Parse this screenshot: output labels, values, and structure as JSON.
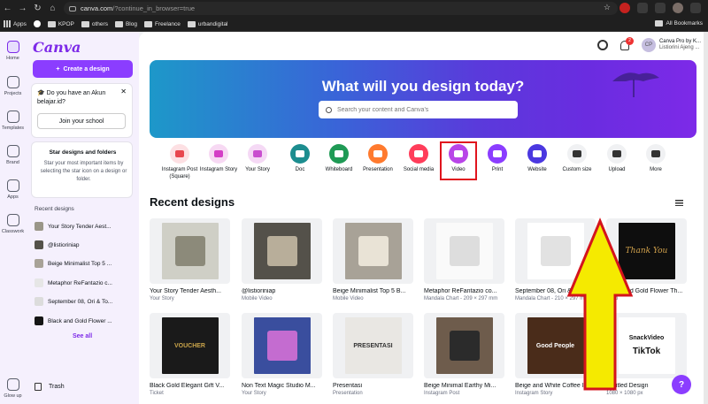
{
  "browser": {
    "url_main": "canva.com",
    "url_rest": "/?continue_in_browser=true",
    "bookmarks": [
      "Apps",
      "KPOP",
      "others",
      "Blog",
      "Freelance",
      "urbandigital"
    ],
    "all_bookmarks": "All Bookmarks"
  },
  "rail": {
    "items": [
      "Home",
      "Projects",
      "Templates",
      "Brand",
      "Apps",
      "Classwork",
      "Glow up"
    ]
  },
  "sidebar": {
    "logo": "Canva",
    "create_label": "Create a design",
    "akun_text": "Do you have an Akun belajar.id?",
    "join_label": "Join your school",
    "star_title": "Star designs and folders",
    "star_desc": "Star your most important items by selecting the star icon on a design or folder.",
    "recent_title": "Recent designs",
    "recent": [
      "Your Story Tender Aest...",
      "@listioriniap",
      "Beige Minimalist Top 5 ...",
      "Metaphor ReFantazio c...",
      "September 08, Ori & To...",
      "Black and Gold Flower ..."
    ],
    "see_all": "See all",
    "trash": "Trash"
  },
  "header": {
    "notif_count": "2",
    "avatar_initials": "CP",
    "profile_name": "Canva Pro by K...",
    "profile_sub": "Listiorini Ajeng ..."
  },
  "banner": {
    "title": "What will you design today?",
    "search_placeholder": "Search your content and Canva's"
  },
  "categories": [
    {
      "label": "Instagram Post (Square)",
      "color": "#fde0e3",
      "icon_color": "#e8474f"
    },
    {
      "label": "Instagram Story",
      "color": "#f7d9f3",
      "icon_color": "#d43fc6"
    },
    {
      "label": "Your Story",
      "color": "#f5d9f5",
      "icon_color": "#c94fcf"
    },
    {
      "label": "Doc",
      "color": "#1c8d8f",
      "icon_color": "#ffffff"
    },
    {
      "label": "Whiteboard",
      "color": "#1f9a55",
      "icon_color": "#ffffff"
    },
    {
      "label": "Presentation",
      "color": "#ff7a2e",
      "icon_color": "#ffffff"
    },
    {
      "label": "Social media",
      "color": "#ff3d5a",
      "icon_color": "#ffffff"
    },
    {
      "label": "Video",
      "color": "#b845e8",
      "icon_color": "#ffffff"
    },
    {
      "label": "Print",
      "color": "#8b3dff",
      "icon_color": "#ffffff"
    },
    {
      "label": "Website",
      "color": "#4b38e0",
      "icon_color": "#ffffff"
    },
    {
      "label": "Custom size",
      "color": "#f0f1f3",
      "icon_color": "#333333"
    },
    {
      "label": "Upload",
      "color": "#f0f1f3",
      "icon_color": "#333333"
    },
    {
      "label": "More",
      "color": "#f0f1f3",
      "icon_color": "#333333"
    }
  ],
  "recent_heading": "Recent designs",
  "designs": [
    {
      "name": "Your Story Tender Aesth...",
      "type": "Your Story",
      "bg": "#cfcfc6",
      "art": "#8c8a7a"
    },
    {
      "name": "@listioriniap",
      "type": "Mobile Video",
      "bg": "#54514a",
      "art": "#b8ae9a"
    },
    {
      "name": "Beige Minimalist Top 5 B...",
      "type": "Mobile Video",
      "bg": "#a8a297",
      "art": "#e9e3d6"
    },
    {
      "name": "Metaphor ReFantazio co...",
      "type": "Mandala Chart - 209 × 297 mm",
      "bg": "#fafafa",
      "art": "#dddddd"
    },
    {
      "name": "September 08, Ori & Toro...",
      "type": "Mandala Chart - 210 × 297 mm",
      "bg": "#ffffff",
      "art": "#e2e2e2"
    },
    {
      "name": "Black and Gold Flower Th...",
      "type": "Card",
      "bg": "#0e0e0e",
      "art": "#d2a24c"
    },
    {
      "name": "Black Gold Elegant Gift V...",
      "type": "Ticket",
      "bg": "#1a1a1a",
      "art": "#c9a44a"
    },
    {
      "name": "Non Text Magic Studio M...",
      "type": "Your Story",
      "bg": "#3a4e9e",
      "art": "#c46cd0"
    },
    {
      "name": "Presentasi",
      "type": "Presentation",
      "bg": "#e9e7e3",
      "art": "#ffffff"
    },
    {
      "name": "Beige Minimal Earthy Mi...",
      "type": "Instagram Post",
      "bg": "#6e5c4c",
      "art": "#2b2b2b"
    },
    {
      "name": "Beige and White Coffee I...",
      "type": "Instagram Story",
      "bg": "#4a2c1a",
      "art": "#7a4a2a"
    },
    {
      "name": "Untitled Design",
      "type": "1080 × 1080 px",
      "bg": "#ffffff",
      "art": "#111111"
    }
  ],
  "thumb_texts": {
    "gift": "VOUCHER",
    "thanks": "Thank You",
    "pres": "PRESENTASI",
    "coffee": "Good People",
    "snack": "SnackVideo",
    "tiktok": "TikTok"
  },
  "help": "?"
}
